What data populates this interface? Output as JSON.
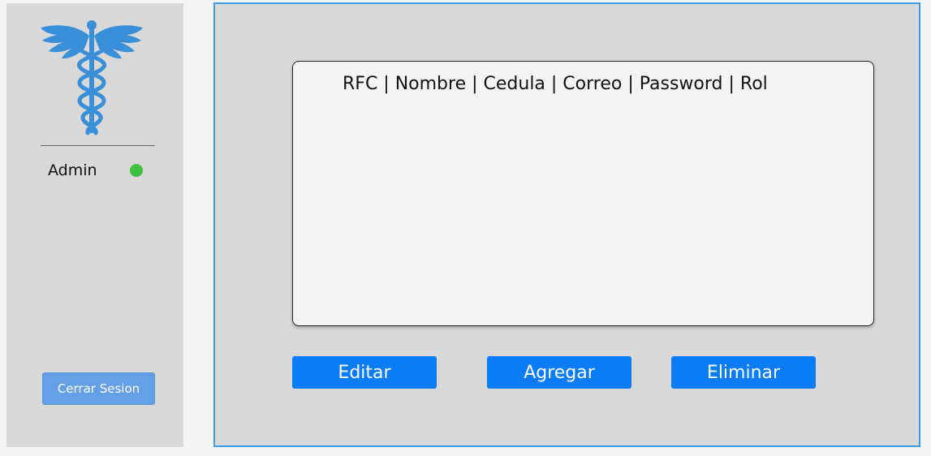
{
  "sidebar": {
    "logo_icon": "caduceus-icon",
    "user_name": "Admin",
    "status_color": "#3fbf3f",
    "logout_label": "Cerrar Sesion"
  },
  "main": {
    "list_header": "RFC | Nombre | Cedula | Correo | Password | Rol",
    "buttons": {
      "edit": "Editar",
      "add": "Agregar",
      "delete": "Eliminar"
    }
  },
  "colors": {
    "accent": "#0a7cf5",
    "panel_border": "#3d9ae8",
    "logo": "#3a8fd9"
  }
}
